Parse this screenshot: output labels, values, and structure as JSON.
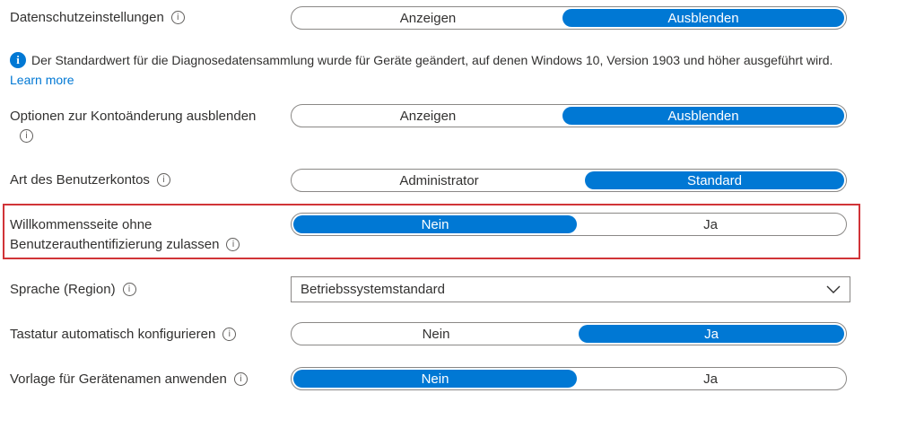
{
  "settings": {
    "datenschutz": {
      "label": "Datenschutzeinstellungen",
      "options": [
        "Anzeigen",
        "Ausblenden"
      ],
      "selected": 1
    },
    "notice": {
      "text": "Der Standardwert für die Diagnosedatensammlung wurde für Geräte geändert, auf denen Windows 10, Version 1903 und höher ausgeführt wird.",
      "link": "Learn more"
    },
    "kontoaenderung": {
      "label": "Optionen zur Kontoänderung ausblenden",
      "options": [
        "Anzeigen",
        "Ausblenden"
      ],
      "selected": 1
    },
    "benutzerkonto": {
      "label": "Art des Benutzerkontos",
      "options": [
        "Administrator",
        "Standard"
      ],
      "selected": 1
    },
    "willkommensseite": {
      "label_line1": "Willkommensseite ohne",
      "label_line2": "Benutzerauthentifizierung zulassen",
      "options": [
        "Nein",
        "Ja"
      ],
      "selected": 0
    },
    "sprache": {
      "label": "Sprache (Region)",
      "value": "Betriebssystemstandard"
    },
    "tastatur": {
      "label": "Tastatur automatisch konfigurieren",
      "options": [
        "Nein",
        "Ja"
      ],
      "selected": 1
    },
    "geraetename": {
      "label": "Vorlage für Gerätenamen anwenden",
      "options": [
        "Nein",
        "Ja"
      ],
      "selected": 0
    }
  },
  "icons": {
    "info": "info-icon",
    "notice": "info-filled-icon",
    "dropdown": "chevron-down-icon"
  },
  "colors": {
    "accent": "#0078d4",
    "highlight_border": "#d13438"
  }
}
